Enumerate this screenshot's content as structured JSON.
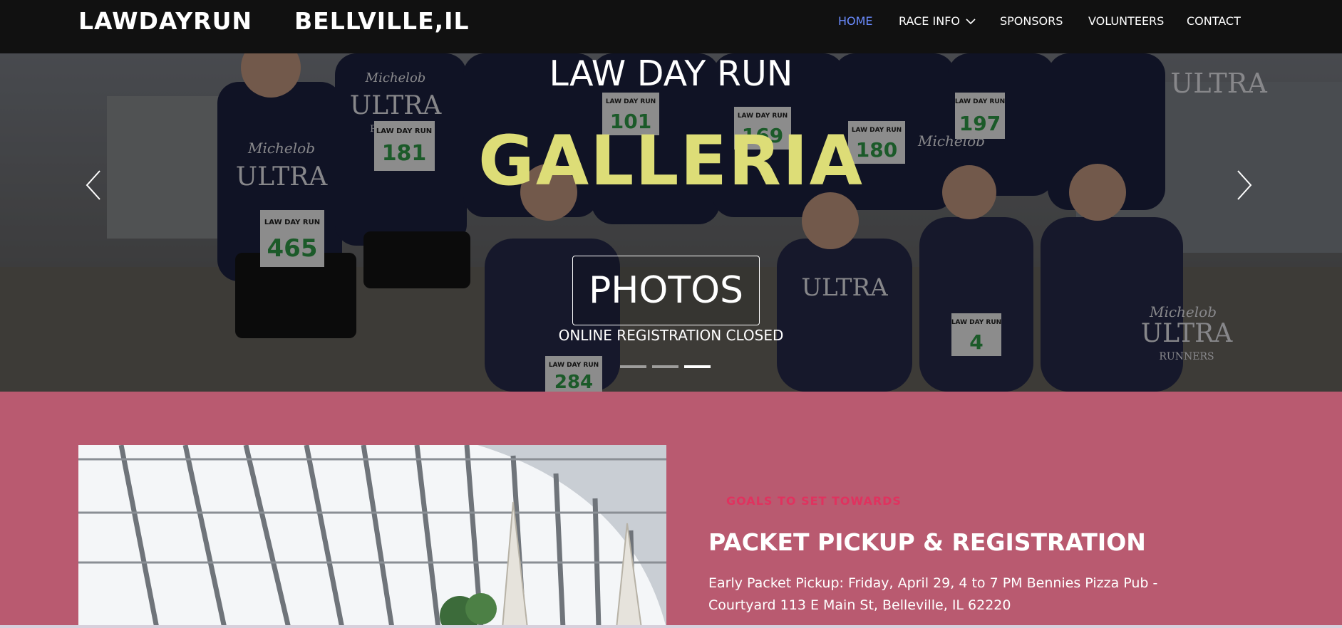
{
  "nav": {
    "brand": "LAWDAYRUN",
    "city": "BELLVILLE,IL",
    "items": [
      {
        "label": "HOME",
        "active": true
      },
      {
        "label": "RACE INFO",
        "dropdown": true
      },
      {
        "label": "SPONSORS"
      },
      {
        "label": "VOLUNTEERS"
      },
      {
        "label": "CONTACT"
      }
    ],
    "icons": {
      "dropdown": "chevron-down-icon"
    }
  },
  "hero": {
    "kicker": "LAW DAY RUN",
    "title": "GALLERIA",
    "button_label": "PHOTOS",
    "subtitle": "ONLINE REGISTRATION CLOSED",
    "slide_count": 3,
    "active_slide": 3,
    "icons": {
      "prev": "chevron-left-icon",
      "next": "chevron-right-icon"
    },
    "shirt_text": [
      "Michelob",
      "ULTRA",
      "RUNNERS"
    ],
    "bibs": [
      {
        "label": "LAW DAY RUN",
        "number": "465"
      },
      {
        "label": "LAW DAY RUN",
        "number": "181"
      },
      {
        "label": "LAW DAY RUN",
        "number": "101"
      },
      {
        "label": "LAW DAY RUN",
        "number": "169"
      },
      {
        "label": "LAW DAY RUN",
        "number": "180"
      },
      {
        "label": "LAW DAY RUN",
        "number": "197"
      },
      {
        "label": "LAW DAY RUN",
        "number": "284"
      },
      {
        "label": "LAW DAY RUN",
        "number": "4"
      }
    ]
  },
  "info": {
    "label": "GOALS TO SET TOWARDS",
    "heading": "PACKET PICKUP & REGISTRATION",
    "text": "Early Packet Pickup: Friday, April 29, 4 to 7 PM Bennies Pizza Pub - Courtyard 113 E Main St, Belleville, IL 62220"
  },
  "colors": {
    "nav_bg": "#111111",
    "active_link": "#6b8cff",
    "title_yellow": "#dddd77",
    "section_bg": "#b95a70",
    "label_red": "#e0325f"
  }
}
